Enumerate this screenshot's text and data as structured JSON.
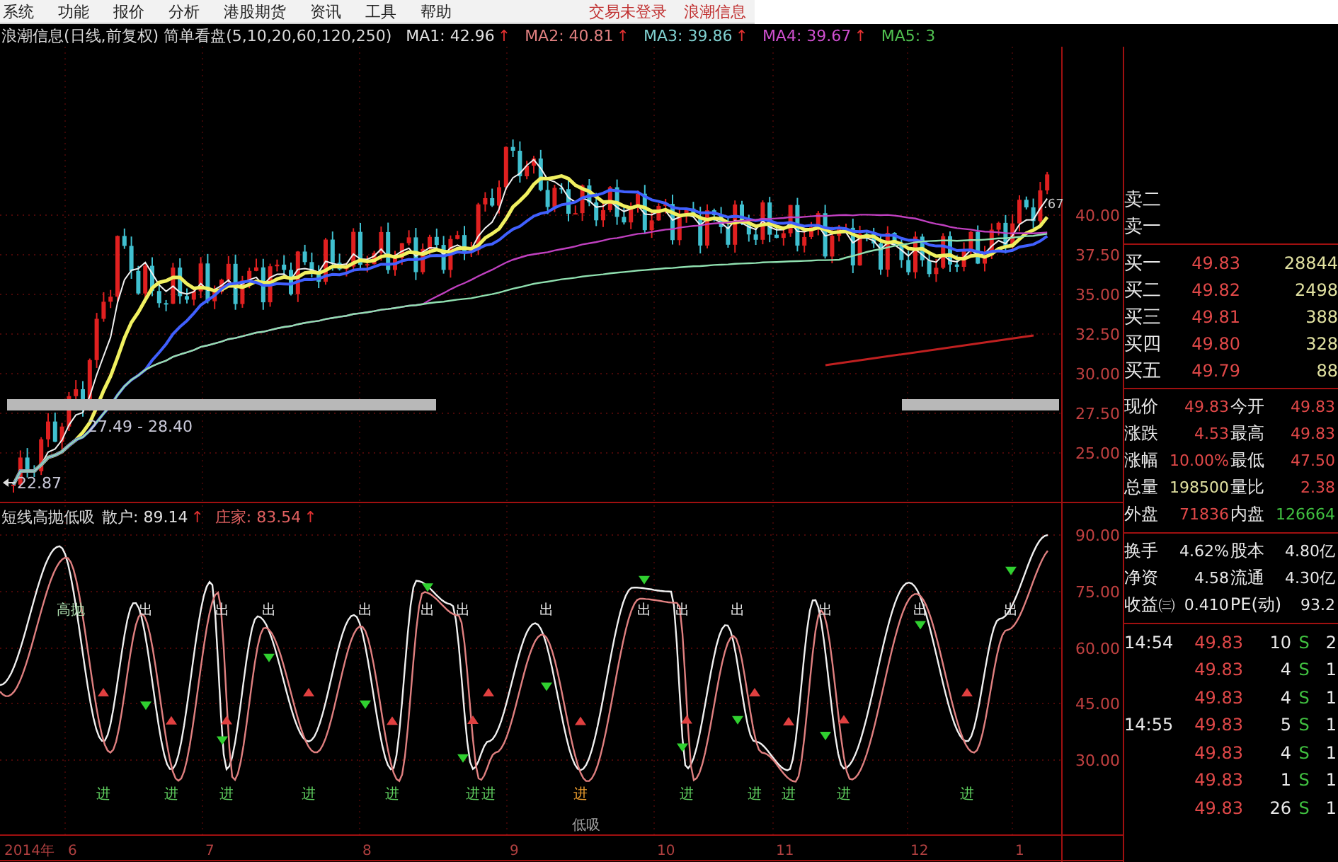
{
  "menu": {
    "items": [
      "系统",
      "功能",
      "报价",
      "分析",
      "港股期货",
      "资讯",
      "工具",
      "帮助"
    ],
    "status": [
      "交易未登录",
      "浪潮信息"
    ]
  },
  "title_bar": {
    "title": "浪潮信息(日线,前复权) 简单看盘(5,10,20,60,120,250)",
    "indicators": [
      {
        "label": "MA1:",
        "value": "42.96",
        "arrow": "↑",
        "color": "#e0e0e0"
      },
      {
        "label": "MA2:",
        "value": "40.81",
        "arrow": "↑",
        "color": "#e08080"
      },
      {
        "label": "MA3:",
        "value": "39.86",
        "arrow": "↑",
        "color": "#80d0d0"
      },
      {
        "label": "MA4:",
        "value": "39.67",
        "arrow": "↑",
        "color": "#d050d0"
      },
      {
        "label": "MA5:",
        "value": "3",
        "color": "#50c050"
      }
    ]
  },
  "price_chart": {
    "y_axis": [
      "40.00",
      "37.50",
      "35.00",
      "32.50",
      "30.00",
      "27.50",
      "25.00"
    ],
    "range_label": "27.49 - 28.40",
    "low_label": "22.87",
    "high_label": ".67"
  },
  "indicator_chart": {
    "name": "短线高抛低吸",
    "lines": [
      {
        "label": "散户:",
        "value": "89.14",
        "arrow": "↑",
        "color": "#e0e0e0"
      },
      {
        "label": "庄家:",
        "value": "83.54",
        "arrow": "↑",
        "color": "#e06060"
      }
    ],
    "y_axis": [
      "90.00",
      "75.00",
      "60.00",
      "45.00",
      "30.00"
    ],
    "signals": [
      {
        "text": "高抛",
        "kind": "high"
      },
      {
        "text": "出",
        "kind": "sell"
      },
      {
        "text": "出",
        "kind": "sell"
      },
      {
        "text": "出",
        "kind": "sell"
      },
      {
        "text": "出",
        "kind": "sell"
      },
      {
        "text": "出",
        "kind": "sell"
      },
      {
        "text": "出",
        "kind": "sell"
      },
      {
        "text": "出",
        "kind": "sell"
      },
      {
        "text": "出",
        "kind": "sell"
      },
      {
        "text": "出",
        "kind": "sell"
      },
      {
        "text": "出",
        "kind": "sell"
      },
      {
        "text": "出",
        "kind": "sell"
      },
      {
        "text": "出",
        "kind": "sell"
      },
      {
        "text": "出",
        "kind": "sell"
      },
      {
        "text": "进",
        "kind": "buy"
      },
      {
        "text": "进",
        "kind": "buy"
      },
      {
        "text": "进",
        "kind": "buy"
      },
      {
        "text": "进",
        "kind": "buy"
      },
      {
        "text": "进",
        "kind": "buy"
      },
      {
        "text": "进",
        "kind": "buy"
      },
      {
        "text": "进",
        "kind": "buy"
      },
      {
        "text": "进",
        "kind": "key"
      },
      {
        "text": "进",
        "kind": "buy"
      },
      {
        "text": "进",
        "kind": "buy"
      },
      {
        "text": "进",
        "kind": "buy"
      },
      {
        "text": "进",
        "kind": "buy"
      },
      {
        "text": "进",
        "kind": "buy"
      },
      {
        "text": "低吸",
        "kind": "low"
      }
    ]
  },
  "x_axis": [
    "2014年",
    "6",
    "7",
    "8",
    "9",
    "10",
    "11",
    "12",
    "1"
  ],
  "quote_panel": {
    "asks": [
      {
        "label": "卖二"
      },
      {
        "label": "卖一"
      }
    ],
    "bids": [
      {
        "label": "买一",
        "price": "49.83",
        "volume": "28844"
      },
      {
        "label": "买二",
        "price": "49.82",
        "volume": "2498"
      },
      {
        "label": "买三",
        "price": "49.81",
        "volume": "388"
      },
      {
        "label": "买四",
        "price": "49.80",
        "volume": "328"
      },
      {
        "label": "买五",
        "price": "49.79",
        "volume": "88"
      }
    ],
    "stats": [
      [
        [
          {
            "label": "现价",
            "value": "49.83",
            "color": "#e04848"
          },
          {
            "label": "今开",
            "value": "49.83",
            "color": "#e04848"
          }
        ],
        [
          {
            "label": "涨跌",
            "value": "4.53",
            "color": "#e04848"
          },
          {
            "label": "最高",
            "value": "49.83",
            "color": "#e04848"
          }
        ],
        [
          {
            "label": "涨幅",
            "value": "10.00%",
            "color": "#e04848"
          },
          {
            "label": "最低",
            "value": "47.50",
            "color": "#e04848"
          }
        ],
        [
          {
            "label": "总量",
            "value": "198500",
            "color": "#e0e0a0"
          },
          {
            "label": "量比",
            "value": "2.38",
            "color": "#e04848"
          }
        ],
        [
          {
            "label": "外盘",
            "value": "71836",
            "color": "#e04848"
          },
          {
            "label": "内盘",
            "value": "126664",
            "color": "#40c040"
          }
        ]
      ],
      [
        [
          {
            "label": "换手",
            "value": "4.62%",
            "color": "#e8e8e8"
          },
          {
            "label": "股本",
            "value": "4.80亿",
            "color": "#e8e8e8"
          }
        ],
        [
          {
            "label": "净资",
            "value": "4.58",
            "color": "#e8e8e8"
          },
          {
            "label": "流通",
            "value": "4.30亿",
            "color": "#e8e8e8"
          }
        ],
        [
          {
            "label": "收益㈢",
            "value": "0.410",
            "color": "#e8e8e8"
          },
          {
            "label": "PE(动)",
            "value": "93.2",
            "color": "#e8e8e8"
          }
        ]
      ]
    ],
    "ticks": [
      {
        "time": "14:54",
        "price": "49.83",
        "volume": "10",
        "side": "S",
        "column_5": "2"
      },
      {
        "price": "49.83",
        "volume": "4",
        "side": "S",
        "column_5": "1"
      },
      {
        "price": "49.83",
        "volume": "4",
        "side": "S",
        "column_5": "1"
      },
      {
        "time": "14:55",
        "price": "49.83",
        "volume": "5",
        "side": "S",
        "column_5": "1"
      },
      {
        "price": "49.83",
        "volume": "4",
        "side": "S",
        "column_5": "1"
      },
      {
        "price": "49.83",
        "volume": "1",
        "side": "S",
        "column_5": "1"
      },
      {
        "price": "49.83",
        "volume": "26",
        "side": "S",
        "column_5": "1"
      }
    ]
  }
}
